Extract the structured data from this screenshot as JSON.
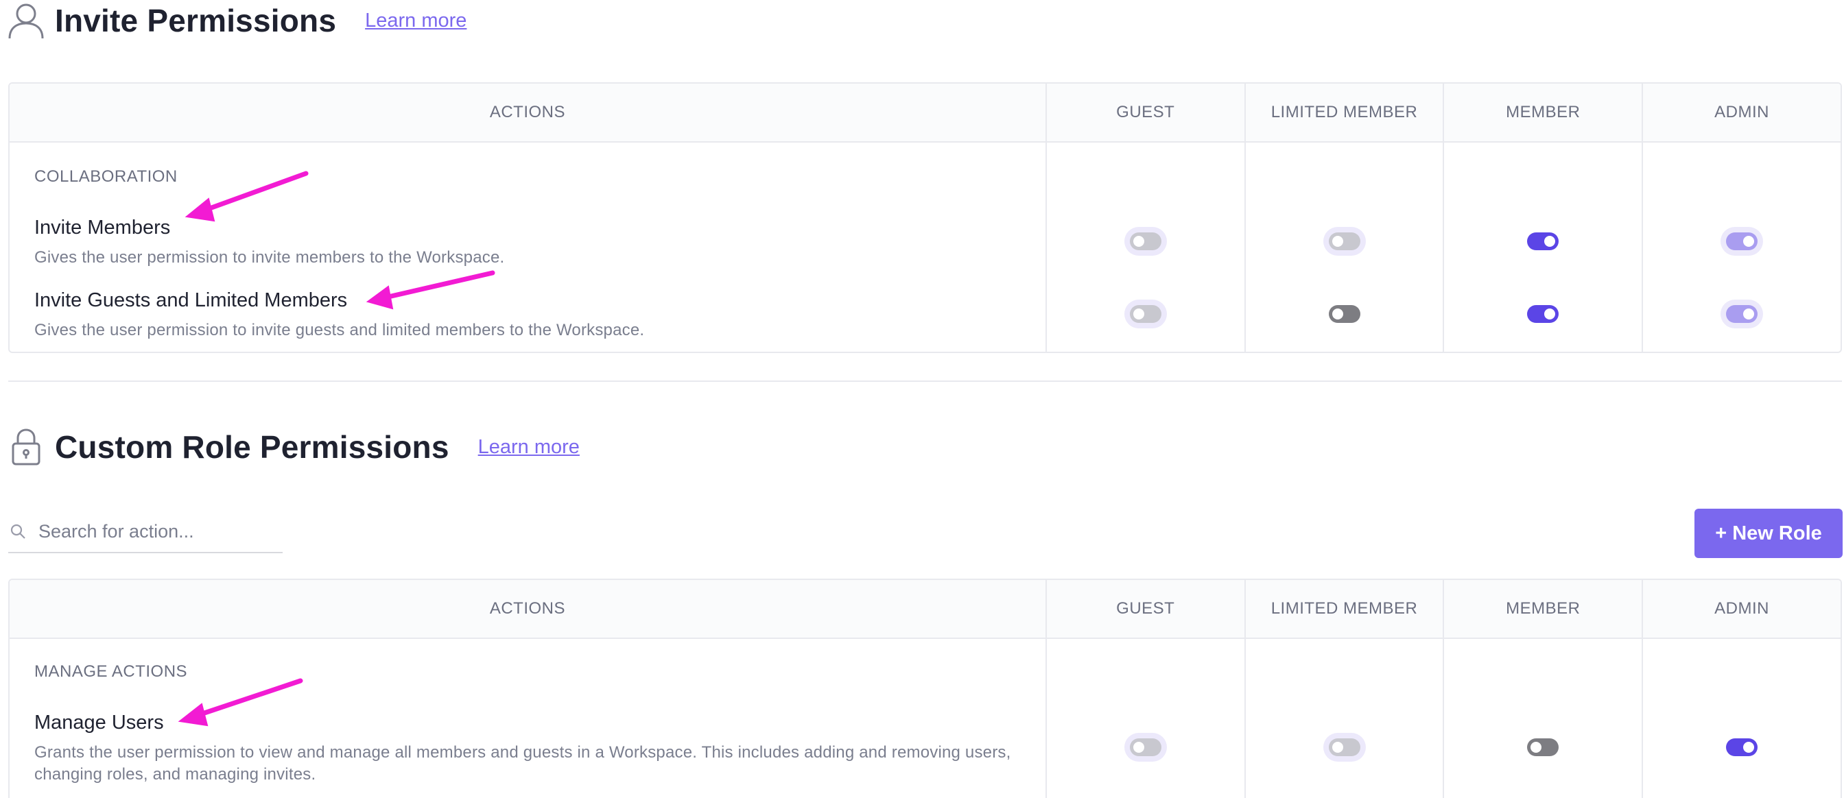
{
  "invite_section": {
    "title": "Invite Permissions",
    "learn_more": "Learn more",
    "table": {
      "headers": [
        "ACTIONS",
        "GUEST",
        "LIMITED MEMBER",
        "MEMBER",
        "ADMIN"
      ],
      "category": "COLLABORATION",
      "rows": [
        {
          "title": "Invite Members",
          "description": "Gives the user permission to invite members to the Workspace.",
          "toggles": {
            "guest": "off-disabled",
            "limited_member": "off-disabled",
            "member": "on-enabled",
            "admin": "on-disabled"
          }
        },
        {
          "title": "Invite Guests and Limited Members",
          "description": "Gives the user permission to invite guests and limited members to the Workspace.",
          "toggles": {
            "guest": "off-disabled",
            "limited_member": "off-enabled",
            "member": "on-enabled",
            "admin": "on-disabled"
          }
        }
      ]
    }
  },
  "custom_section": {
    "title": "Custom Role Permissions",
    "learn_more": "Learn more",
    "search": {
      "placeholder": "Search for action...",
      "value": ""
    },
    "new_role_button": "+ New Role",
    "table": {
      "headers": [
        "ACTIONS",
        "GUEST",
        "LIMITED MEMBER",
        "MEMBER",
        "ADMIN"
      ],
      "category": "MANAGE ACTIONS",
      "rows": [
        {
          "title": "Manage Users",
          "description": "Grants the user permission to view and manage all members and guests in a Workspace. This includes adding and removing users, changing roles, and managing invites.",
          "toggles": {
            "guest": "off-disabled",
            "limited_member": "off-disabled",
            "member": "off-enabled",
            "admin": "on-enabled"
          }
        }
      ]
    }
  },
  "icons": {
    "invite_section": "user-icon",
    "custom_section": "lock-icon",
    "search": "search-icon"
  },
  "colors": {
    "accent": "#7b68ee",
    "toggle_on": "#5b45e6",
    "toggle_on_disabled": "#a99df0",
    "toggle_off": "#7d7d82",
    "toggle_off_disabled": "#c8c8cf",
    "annotation_arrow": "#f21bd3"
  }
}
